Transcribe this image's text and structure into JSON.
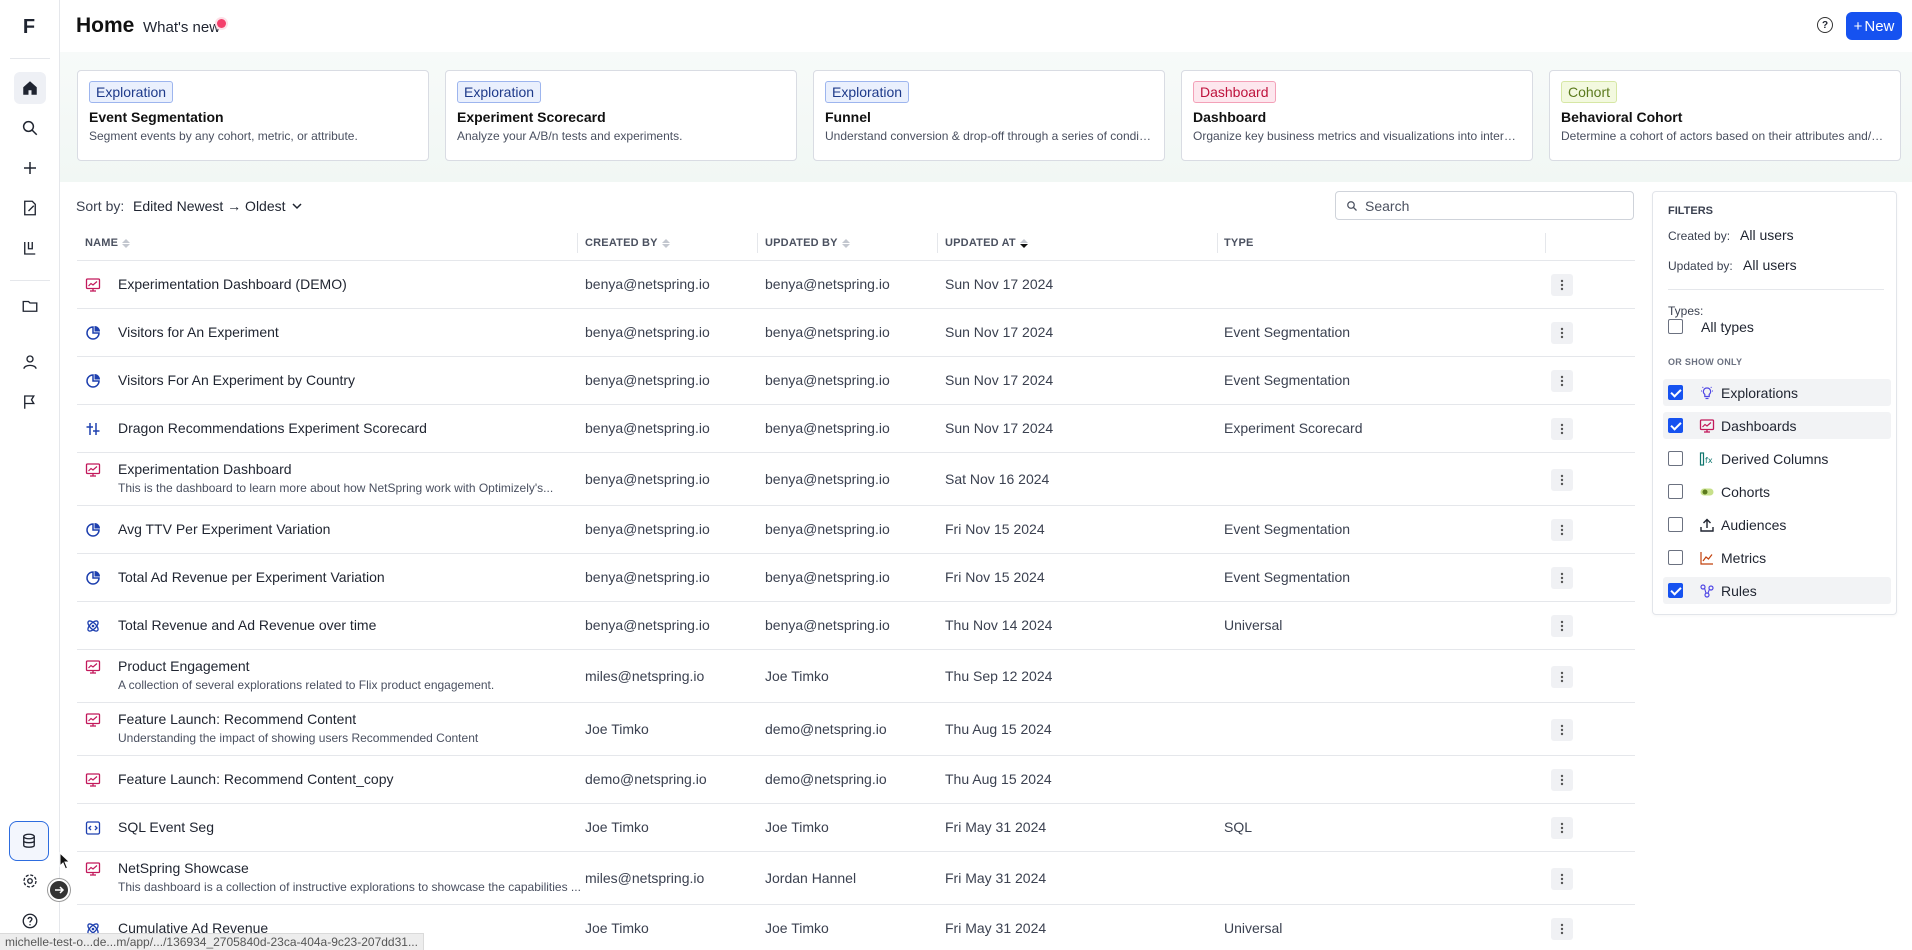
{
  "rail": {
    "logo": "F"
  },
  "header": {
    "title": "Home",
    "whats_new": "What's new",
    "help": "?",
    "new_button": "New"
  },
  "cards": [
    {
      "tag": "Exploration",
      "tag_kind": "exp",
      "title": "Event Segmentation",
      "desc": "Segment events by any cohort, metric, or attribute."
    },
    {
      "tag": "Exploration",
      "tag_kind": "exp",
      "title": "Experiment Scorecard",
      "desc": "Analyze your A/B/n tests and experiments."
    },
    {
      "tag": "Exploration",
      "tag_kind": "exp",
      "title": "Funnel",
      "desc": "Understand conversion & drop-off through a series of conditi..."
    },
    {
      "tag": "Dashboard",
      "tag_kind": "dash",
      "title": "Dashboard",
      "desc": "Organize key business metrics and visualizations into interacti..."
    },
    {
      "tag": "Cohort",
      "tag_kind": "coh",
      "title": "Behavioral Cohort",
      "desc": "Determine a cohort of actors based on their attributes and/or ..."
    }
  ],
  "sort": {
    "label": "Sort by:",
    "value": "Edited Newest → Oldest"
  },
  "search": {
    "placeholder": "Search"
  },
  "table": {
    "columns": {
      "name": "NAME",
      "created_by": "CREATED BY",
      "updated_by": "UPDATED BY",
      "updated_at": "UPDATED AT",
      "type": "TYPE"
    },
    "rows": [
      {
        "icon": "dashboard",
        "name": "Experimentation Dashboard (DEMO)",
        "desc": "",
        "created_by": "benya@netspring.io",
        "updated_by": "benya@netspring.io",
        "updated_at": "Sun Nov 17 2024",
        "type": ""
      },
      {
        "icon": "segmentation",
        "name": "Visitors for An Experiment",
        "desc": "",
        "created_by": "benya@netspring.io",
        "updated_by": "benya@netspring.io",
        "updated_at": "Sun Nov 17 2024",
        "type": "Event Segmentation"
      },
      {
        "icon": "segmentation",
        "name": "Visitors For An Experiment by Country",
        "desc": "",
        "created_by": "benya@netspring.io",
        "updated_by": "benya@netspring.io",
        "updated_at": "Sun Nov 17 2024",
        "type": "Event Segmentation"
      },
      {
        "icon": "scorecard",
        "name": "Dragon Recommendations Experiment Scorecard",
        "desc": "",
        "created_by": "benya@netspring.io",
        "updated_by": "benya@netspring.io",
        "updated_at": "Sun Nov 17 2024",
        "type": "Experiment Scorecard"
      },
      {
        "icon": "dashboard",
        "name": "Experimentation Dashboard",
        "desc": "This is the dashboard to learn more about how NetSpring work with Optimizely's...",
        "created_by": "benya@netspring.io",
        "updated_by": "benya@netspring.io",
        "updated_at": "Sat Nov 16 2024",
        "type": ""
      },
      {
        "icon": "segmentation",
        "name": "Avg TTV Per Experiment Variation",
        "desc": "",
        "created_by": "benya@netspring.io",
        "updated_by": "benya@netspring.io",
        "updated_at": "Fri Nov 15 2024",
        "type": "Event Segmentation"
      },
      {
        "icon": "segmentation",
        "name": "Total Ad Revenue per Experiment Variation",
        "desc": "",
        "created_by": "benya@netspring.io",
        "updated_by": "benya@netspring.io",
        "updated_at": "Fri Nov 15 2024",
        "type": "Event Segmentation"
      },
      {
        "icon": "universal",
        "name": "Total Revenue and Ad Revenue over time",
        "desc": "",
        "created_by": "benya@netspring.io",
        "updated_by": "benya@netspring.io",
        "updated_at": "Thu Nov 14 2024",
        "type": "Universal"
      },
      {
        "icon": "dashboard",
        "name": "Product Engagement",
        "desc": "A collection of several explorations related to Flix product engagement.",
        "created_by": "miles@netspring.io",
        "updated_by": "Joe Timko",
        "updated_at": "Thu Sep 12 2024",
        "type": ""
      },
      {
        "icon": "dashboard",
        "name": "Feature Launch: Recommend Content",
        "desc": "Understanding the impact of showing users Recommended Content",
        "created_by": "Joe Timko",
        "updated_by": "demo@netspring.io",
        "updated_at": "Thu Aug 15 2024",
        "type": ""
      },
      {
        "icon": "dashboard",
        "name": "Feature Launch: Recommend Content_copy",
        "desc": "",
        "created_by": "demo@netspring.io",
        "updated_by": "demo@netspring.io",
        "updated_at": "Thu Aug 15 2024",
        "type": ""
      },
      {
        "icon": "sql",
        "name": "SQL Event Seg",
        "desc": "",
        "created_by": "Joe Timko",
        "updated_by": "Joe Timko",
        "updated_at": "Fri May 31 2024",
        "type": "SQL"
      },
      {
        "icon": "dashboard",
        "name": "NetSpring Showcase",
        "desc": "This dashboard is a collection of instructive explorations to showcase the capabilities ...",
        "created_by": "miles@netspring.io",
        "updated_by": "Jordan Hannel",
        "updated_at": "Fri May 31 2024",
        "type": ""
      },
      {
        "icon": "universal",
        "name": "Cumulative Ad Revenue",
        "desc": "",
        "created_by": "Joe Timko",
        "updated_by": "Joe Timko",
        "updated_at": "Fri May 31 2024",
        "type": "Universal"
      }
    ]
  },
  "filters": {
    "heading": "FILTERS",
    "created_by_label": "Created by:",
    "created_by_value": "All users",
    "updated_by_label": "Updated by:",
    "updated_by_value": "All users",
    "types_label": "Types:",
    "all_types": "All types",
    "all_types_checked": false,
    "or_show_only": "OR SHOW ONLY",
    "options": [
      {
        "label": "Explorations",
        "icon": "bulb",
        "checked": true
      },
      {
        "label": "Dashboards",
        "icon": "dashboard",
        "checked": true
      },
      {
        "label": "Derived Columns",
        "icon": "derived",
        "checked": false
      },
      {
        "label": "Cohorts",
        "icon": "cohort",
        "checked": false
      },
      {
        "label": "Audiences",
        "icon": "upload",
        "checked": false
      },
      {
        "label": "Metrics",
        "icon": "metric",
        "checked": false
      },
      {
        "label": "Rules",
        "icon": "rules",
        "checked": true
      }
    ]
  },
  "status_bar": {
    "url": "michelle-test-o...de...m/app/.../136934_2705840d-23ca-404a-9c23-207dd31..."
  },
  "colors": {
    "accent": "#1652f0",
    "dashboard": "#c2185b",
    "segmentation": "#1e40af"
  }
}
